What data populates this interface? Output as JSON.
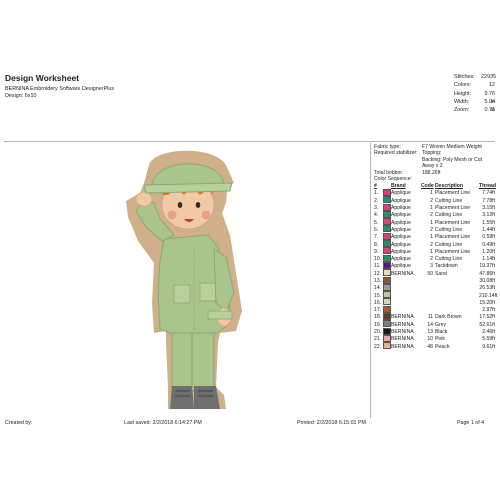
{
  "header": {
    "title": "Design Worksheet",
    "software": "BERNINA Embroidery Software DesignerPlus",
    "design": "Design:  6x10"
  },
  "stats": [
    {
      "label": "Stitches:",
      "value": "22935"
    },
    {
      "label": "Colors:",
      "value": "12"
    },
    {
      "label": "Height:",
      "value": "9.76 in"
    },
    {
      "label": "Width:",
      "value": "5.04 in"
    },
    {
      "label": "Zoom:",
      "value": "0.71"
    }
  ],
  "info": {
    "fabric_label": "Fabric type:",
    "fabric_value": "F7 Woven Medium Weight",
    "stabilizer_label": "Required stabilizer:",
    "stabilizer_value": "Topping:",
    "backing_value": "Backing: Poly Mesh or Cut Away x 2",
    "bobbin_label": "Total bobbin:",
    "bobbin_value": "188.26ft",
    "sequence_label": "Color Sequence:"
  },
  "sequence_headers": {
    "num": "#",
    "brand": "Brand",
    "code": "Code",
    "desc": "Description",
    "thread": "Thread"
  },
  "sequence": [
    {
      "num": "1.",
      "color": "#e0398a",
      "brand": "Applique",
      "code": "1",
      "desc": "Placement Line",
      "thread": "7.74ft"
    },
    {
      "num": "2.",
      "color": "#2f8a6f",
      "brand": "Applique",
      "code": "2",
      "desc": "Cutting Line",
      "thread": "7.78ft"
    },
    {
      "num": "3.",
      "color": "#d8407f",
      "brand": "Applique",
      "code": "1",
      "desc": "Placement Line",
      "thread": "3.15ft"
    },
    {
      "num": "4.",
      "color": "#2f8a6f",
      "brand": "Applique",
      "code": "2",
      "desc": "Cutting Line",
      "thread": "3.12ft"
    },
    {
      "num": "5.",
      "color": "#d8407f",
      "brand": "Applique",
      "code": "1",
      "desc": "Placement Line",
      "thread": "1.55ft"
    },
    {
      "num": "6.",
      "color": "#2f8a6f",
      "brand": "Applique",
      "code": "2",
      "desc": "Cutting Line",
      "thread": "1.44ft"
    },
    {
      "num": "7.",
      "color": "#d8407f",
      "brand": "Applique",
      "code": "1",
      "desc": "Placement Line",
      "thread": "0.59ft"
    },
    {
      "num": "8.",
      "color": "#2f8a6f",
      "brand": "Applique",
      "code": "2",
      "desc": "Cutting Line",
      "thread": "0.49ft"
    },
    {
      "num": "9.",
      "color": "#d8407f",
      "brand": "Applique",
      "code": "1",
      "desc": "Placement Line",
      "thread": "1.20ft"
    },
    {
      "num": "10.",
      "color": "#2f8a6f",
      "brand": "Applique",
      "code": "2",
      "desc": "Cutting Line",
      "thread": "1.14ft"
    },
    {
      "num": "11.",
      "color": "#5b1a7a",
      "brand": "Applique",
      "code": "3",
      "desc": "Tackdown",
      "thread": "19.37ft"
    },
    {
      "num": "12.",
      "color": "#e9d8b6",
      "brand": "BERNINA",
      "code": "50",
      "desc": "Sand",
      "thread": "47.86ft"
    },
    {
      "num": "13.",
      "color": "#8a5a2b",
      "brand": "",
      "code": "",
      "desc": "",
      "thread": "30.08ft"
    },
    {
      "num": "14.",
      "color": "#9c9c9c",
      "brand": "",
      "code": "",
      "desc": "",
      "thread": "26.53ft"
    },
    {
      "num": "15.",
      "color": "#b9c9a3",
      "brand": "",
      "code": "",
      "desc": "",
      "thread": "210.14ft"
    },
    {
      "num": "16.",
      "color": "#cfd9c0",
      "brand": "",
      "code": "",
      "desc": "",
      "thread": "15.20ft"
    },
    {
      "num": "17.",
      "color": "#b5562a",
      "brand": "",
      "code": "",
      "desc": "",
      "thread": "2.97ft"
    },
    {
      "num": "18.",
      "color": "#5e3b1e",
      "brand": "BERNINA",
      "code": "11",
      "desc": "Dark Brown",
      "thread": "17.52ft"
    },
    {
      "num": "19.",
      "color": "#7d7d7d",
      "brand": "BERNINA",
      "code": "14",
      "desc": "Grey",
      "thread": "52.61ft"
    },
    {
      "num": "20.",
      "color": "#1a1a1a",
      "brand": "BERNINA",
      "code": "13",
      "desc": "Black",
      "thread": "2.46ft"
    },
    {
      "num": "21.",
      "color": "#e9a8a8",
      "brand": "BERNINA",
      "code": "10",
      "desc": "Pink",
      "thread": "5.59ft"
    },
    {
      "num": "22.",
      "color": "#e8b48c",
      "brand": "BERNINA",
      "code": "48",
      "desc": "Peach",
      "thread": "9.61ft"
    }
  ],
  "footer": {
    "created": "Created by:",
    "saved": "Last saved:  2/2/2018 6:14:27 PM",
    "printed": "Printed:  2/2/2018 6:15:01 PM",
    "page": "Page 1 of 4"
  }
}
